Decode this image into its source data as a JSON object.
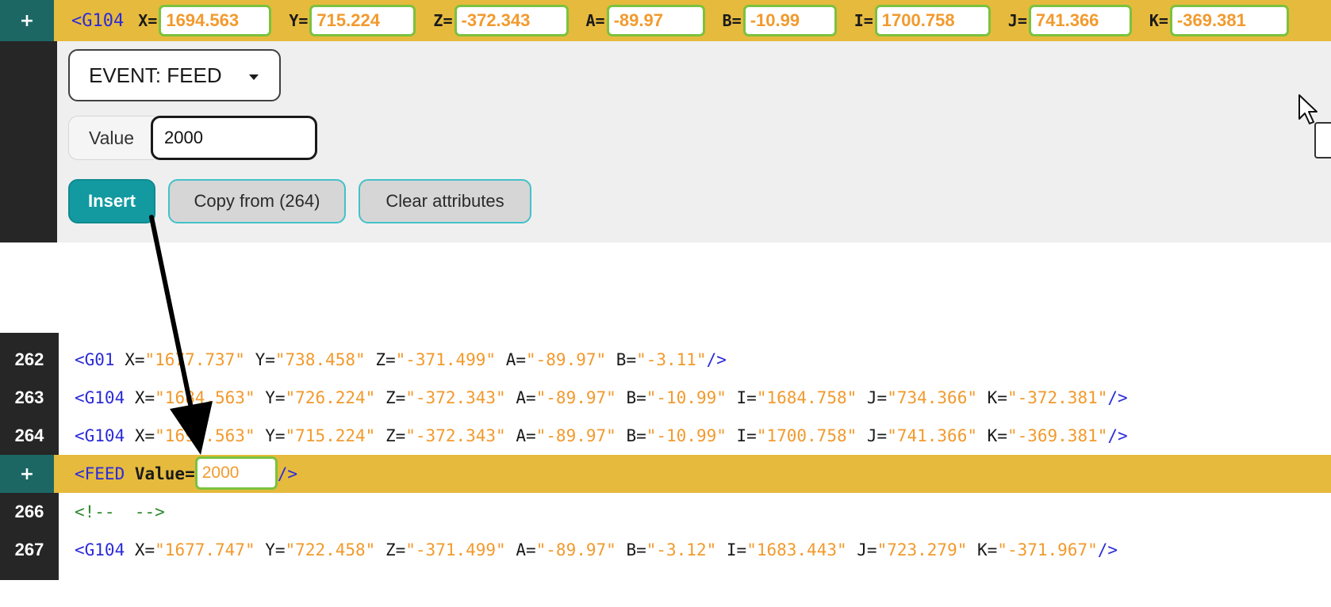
{
  "top_editor": {
    "plus_label": "+",
    "tag_open": "<G104",
    "attributes": [
      {
        "name": "X=",
        "value": "1694.563"
      },
      {
        "name": "Y=",
        "value": "715.224"
      },
      {
        "name": "Z=",
        "value": "-372.343"
      },
      {
        "name": "A=",
        "value": "-89.97"
      },
      {
        "name": "B=",
        "value": "-10.99"
      },
      {
        "name": "I=",
        "value": "1700.758"
      },
      {
        "name": "J=",
        "value": "741.366"
      },
      {
        "name": "K=",
        "value": "-369.381"
      }
    ],
    "event_dropdown": "EVENT: FEED",
    "value_label": "Value",
    "value_input": "2000",
    "buttons": {
      "insert": "Insert",
      "copy_from": "Copy from (264)",
      "clear": "Clear attributes"
    }
  },
  "code_lines": {
    "l262": {
      "num": "262",
      "tag": "<G01",
      "x_key": " X=",
      "x_val": "\"1677.737\"",
      "y_key": " Y=",
      "y_val": "\"738.458\"",
      "z_key": " Z=",
      "z_val": "\"-371.499\"",
      "a_key": " A=",
      "a_val": "\"-89.97\"",
      "b_key": " B=",
      "b_val": "\"-3.11\"",
      "close": "/>"
    },
    "l263": {
      "num": "263",
      "tag": "<G104",
      "x_key": " X=",
      "x_val": "\"1684.563\"",
      "y_key": " Y=",
      "y_val": "\"726.224\"",
      "z_key": " Z=",
      "z_val": "\"-372.343\"",
      "a_key": " A=",
      "a_val": "\"-89.97\"",
      "b_key": " B=",
      "b_val": "\"-10.99\"",
      "i_key": " I=",
      "i_val": "\"1684.758\"",
      "j_key": " J=",
      "j_val": "\"734.366\"",
      "k_key": " K=",
      "k_val": "\"-372.381\"",
      "close": "/>"
    },
    "l264": {
      "num": "264",
      "tag": "<G104",
      "x_key": " X=",
      "x_val": "\"1694.563\"",
      "y_key": " Y=",
      "y_val": "\"715.224\"",
      "z_key": " Z=",
      "z_val": "\"-372.343\"",
      "a_key": " A=",
      "a_val": "\"-89.97\"",
      "b_key": " B=",
      "b_val": "\"-10.99\"",
      "i_key": " I=",
      "i_val": "\"1700.758\"",
      "j_key": " J=",
      "j_val": "\"741.366\"",
      "k_key": " K=",
      "k_val": "\"-369.381\"",
      "close": "/>"
    },
    "feed": {
      "plus": "+",
      "tag": "<FEED",
      "attr": " Value=",
      "value": "2000",
      "close": "/>"
    },
    "l266": {
      "num": "266",
      "comment": "<!--  -->"
    },
    "l267": {
      "num": "267",
      "tag": "<G104",
      "x_key": " X=",
      "x_val": "\"1677.747\"",
      "y_key": " Y=",
      "y_val": "\"722.458\"",
      "z_key": " Z=",
      "z_val": "\"-371.499\"",
      "a_key": " A=",
      "a_val": "\"-89.97\"",
      "b_key": " B=",
      "b_val": "\"-3.12\"",
      "i_key": " I=",
      "i_val": "\"1683.443\"",
      "j_key": " J=",
      "j_val": "\"723.279\"",
      "k_key": " K=",
      "k_val": "\"-371.967\"",
      "close": "/>"
    }
  },
  "colors": {
    "highlight_row": "#e6ba3d",
    "gutter": "#262626",
    "accent_teal": "#129aa0",
    "value_orange": "#f29a2d",
    "tag_blue": "#2b2bd9",
    "box_green": "#7bc23e"
  },
  "icons": {
    "dropdown": "caret-down-icon",
    "pointer": "mouse-pointer-icon",
    "annotation": "arrow-annotation-icon"
  }
}
